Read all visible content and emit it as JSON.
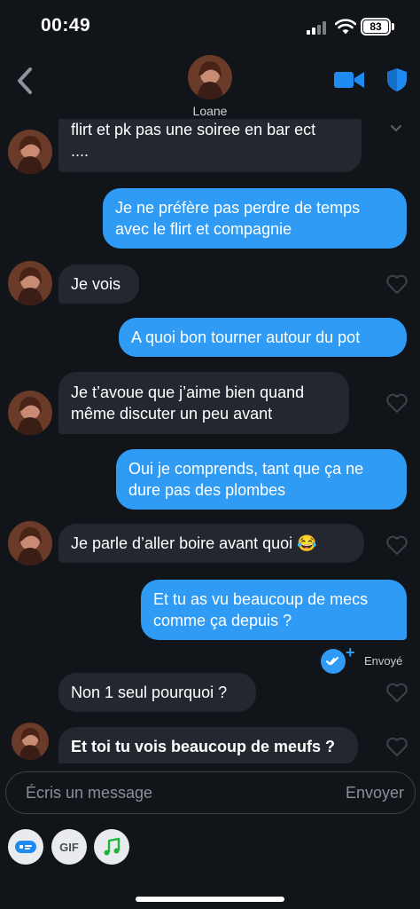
{
  "status_bar": {
    "time": "00:49",
    "battery": "83"
  },
  "header": {
    "contact_name": "Loane"
  },
  "messages": [
    {
      "id": "m1",
      "side": "in",
      "lines": [
        "flirt et pk pas une soiree en bar ect",
        "...."
      ]
    },
    {
      "id": "m2",
      "side": "out",
      "lines": [
        "Je ne préfère pas perdre de temps",
        "avec le flirt et compagnie"
      ]
    },
    {
      "id": "m3",
      "side": "in",
      "lines": [
        "Je vois"
      ]
    },
    {
      "id": "m4",
      "side": "out",
      "lines": [
        "A quoi bon tourner autour du pot"
      ]
    },
    {
      "id": "m5",
      "side": "in",
      "lines": [
        "Je t’avoue que j’aime bien quand",
        "même discuter un peu avant"
      ]
    },
    {
      "id": "m6",
      "side": "out",
      "lines": [
        "Oui je comprends, tant que ça ne",
        "dure pas des plombes"
      ]
    },
    {
      "id": "m7",
      "side": "in",
      "lines": [
        "Je parle d’aller boire avant quoi 😂"
      ]
    },
    {
      "id": "m8",
      "side": "out",
      "lines": [
        "Et tu as vu beaucoup de mecs",
        "comme ça depuis ?"
      ]
    },
    {
      "id": "m9",
      "side": "in",
      "lines": [
        "Non 1 seul pourquoi ?"
      ]
    },
    {
      "id": "m10",
      "side": "in",
      "lines": [
        "Et toi tu vois beaucoup de meufs ?"
      ]
    }
  ],
  "read_receipt": {
    "label": "Envoyé"
  },
  "composer": {
    "placeholder": "Écris un message",
    "send_label": "Envoyer"
  },
  "toolbar": {
    "gif_label": "GIF"
  },
  "icons": [
    "back-icon",
    "video-call-icon",
    "shield-icon",
    "heart-icon",
    "read-check-icon",
    "sticker-icon",
    "gif-icon",
    "music-icon"
  ],
  "colors": {
    "background": "#111418",
    "incoming_bubble": "#23272f",
    "outgoing_bubble": "#2f9bf4",
    "accent": "#1f8af0"
  }
}
